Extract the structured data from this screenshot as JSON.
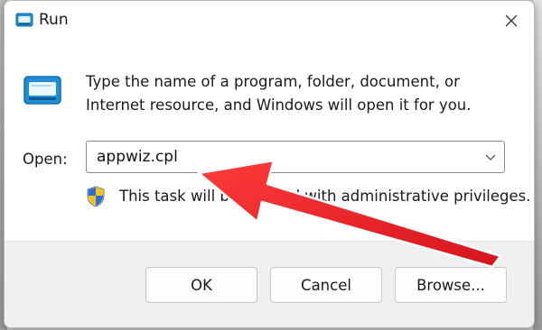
{
  "window": {
    "title": "Run",
    "close_glyph": "✕"
  },
  "content": {
    "description_line1": "Type the name of a program, folder, document, or",
    "description_line2": "Internet resource, and Windows will open it for you.",
    "open_label": "Open:",
    "open_value": "appwiz.cpl",
    "admin_note": "This task will be created with administrative privileges."
  },
  "buttons": {
    "ok": "OK",
    "cancel": "Cancel",
    "browse": "Browse..."
  },
  "icons": {
    "title": "run-icon",
    "main": "run-icon",
    "shield": "uac-shield-icon",
    "dropdown": "chevron-down-icon",
    "close": "close-icon"
  },
  "colors": {
    "accent": "#1f8fd8",
    "annotation_arrow": "#e8232a"
  }
}
